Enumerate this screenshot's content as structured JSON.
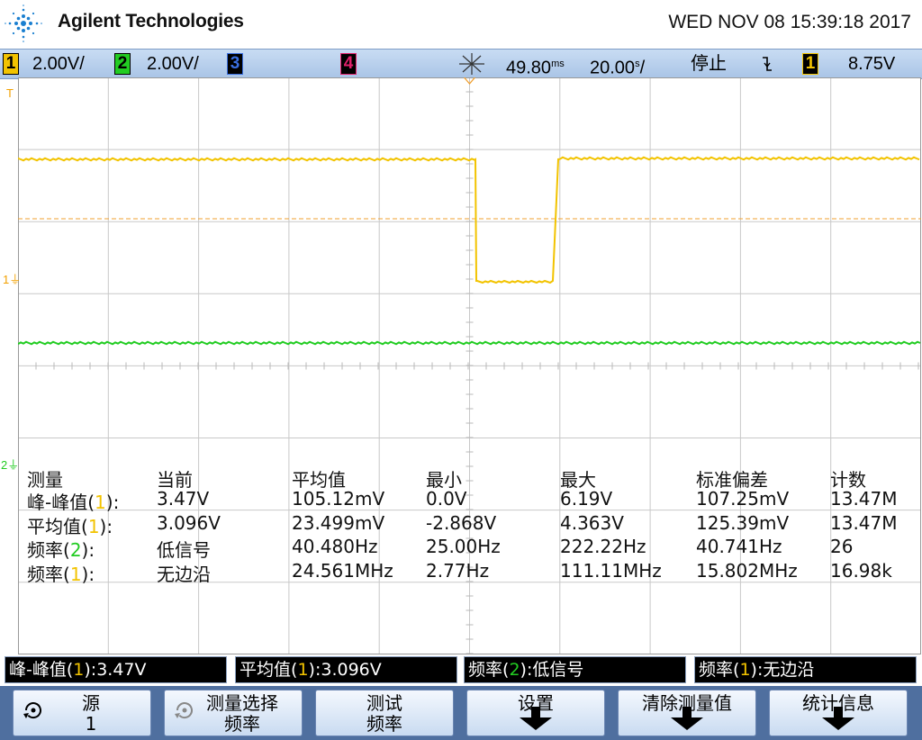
{
  "header": {
    "brand": "Agilent Technologies",
    "datetime": "WED NOV 08 15:39:18 2017"
  },
  "status": {
    "ch1_num": "1",
    "ch1_scale": "2.00V/",
    "ch2_num": "2",
    "ch2_scale": "2.00V/",
    "ch3_num": "3",
    "ch4_num": "4",
    "time_offset": "49.80",
    "time_offset_unit": "ms",
    "time_scale": "20.00",
    "time_scale_unit": "s",
    "time_scale_suffix": "/",
    "run_state": "停止",
    "trigger_slope_icon": "falling-edge-icon",
    "trig_src": "1",
    "trig_level": "8.75V",
    "colors": {
      "ch1": "#f2c300",
      "ch2": "#22cc22",
      "ch3": "#3a6fe0",
      "ch4": "#e0206a"
    }
  },
  "markers": {
    "trigger": "T",
    "ch1_ground": "1",
    "ch2_ground": "2"
  },
  "measurements": {
    "headers": [
      "测量",
      "当前",
      "平均值",
      "最小",
      "最大",
      "标准偏差",
      "计数"
    ],
    "rows": [
      {
        "name": "峰-峰值",
        "src": "1",
        "current": "3.47V",
        "mean": "105.12mV",
        "min": "0.0V",
        "max": "6.19V",
        "std": "107.25mV",
        "count": "13.47M"
      },
      {
        "name": "平均值",
        "src": "1",
        "current": "3.096V",
        "mean": "23.499mV",
        "min": "-2.868V",
        "max": "4.363V",
        "std": "125.39mV",
        "count": "13.47M"
      },
      {
        "name": "频率",
        "src": "2",
        "current": "低信号",
        "mean": "40.480Hz",
        "min": "25.00Hz",
        "max": "222.22Hz",
        "std": "40.741Hz",
        "count": "26"
      },
      {
        "name": "频率",
        "src": "1",
        "current": "无边沿",
        "mean": "24.561MHz",
        "min": "2.77Hz",
        "max": "111.11MHz",
        "std": "15.802MHz",
        "count": "16.98k"
      }
    ]
  },
  "summary": [
    {
      "name": "峰-峰值",
      "src": "1",
      "value": "3.47V"
    },
    {
      "name": "平均值",
      "src": "1",
      "value": "3.096V"
    },
    {
      "name": "频率",
      "src": "2",
      "value": "低信号"
    },
    {
      "name": "频率",
      "src": "1",
      "value": "无边沿"
    }
  ],
  "softkeys": [
    {
      "line1": "源",
      "line2": "1",
      "icon": "rotate-knob-icon"
    },
    {
      "line1": "测量选择",
      "line2": "频率",
      "icon": "rotate-knob-icon"
    },
    {
      "line1": "测试",
      "line2": "频率"
    },
    {
      "line1": "设置",
      "arrow": "down-arrow-icon"
    },
    {
      "line1": "清除测量值",
      "arrow": "down-arrow-icon"
    },
    {
      "line1": "统计信息",
      "arrow": "down-arrow-icon"
    }
  ]
}
